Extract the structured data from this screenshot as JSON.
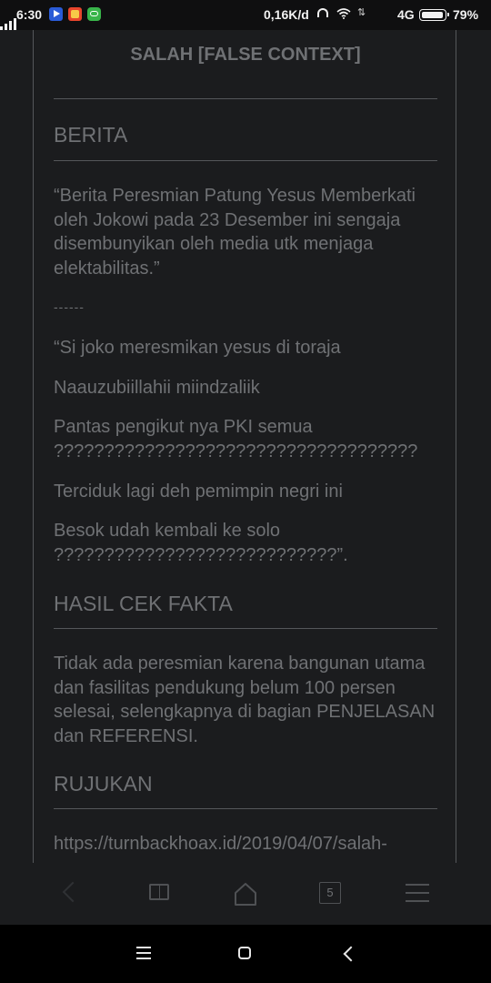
{
  "status_bar": {
    "time": "6:30",
    "net_speed": "0,16K/d",
    "network_type": "4G",
    "battery": "79%"
  },
  "article": {
    "verdict": "SALAH [FALSE CONTEXT]",
    "section_berita": "BERITA",
    "berita_quote": "“Berita Peresmian Patung Yesus Memberkati oleh Jokowi pada 23 Desember ini sengaja disembunyikan oleh media utk menjaga elektabilitas.”",
    "separator": "------",
    "post_line1": "“Si joko meresmikan yesus di toraja",
    "post_line2": "Naauzubiillahii miindzaliik",
    "post_line3": "Pantas pengikut nya PKI semua ????????????????????????????????????",
    "post_line4": "Terciduk lagi deh pemimpin negri ini",
    "post_line5": "Besok udah kembali ke solo ????????????????????????????”.",
    "section_hasil": "HASIL CEK FAKTA",
    "hasil_text": "Tidak ada peresmian karena bangunan utama dan fasilitas pendukung belum 100 persen selesai, selengkapnya di bagian PENJELASAN dan REFERENSI.",
    "section_rujukan": "RUJUKAN",
    "rujukan_link": "https://turnbackhoax.id/2019/04/07/salah-"
  },
  "browser_nav": {
    "tab_count": "5"
  },
  "colors": {
    "background": "#1b1c1e",
    "text": "#6f7174",
    "rule": "#55575a"
  }
}
